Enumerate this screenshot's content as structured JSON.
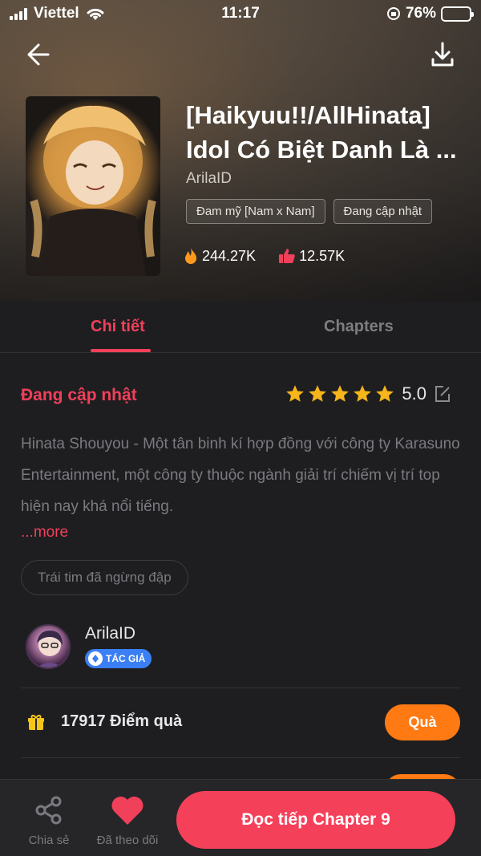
{
  "status_bar": {
    "carrier": "Viettel",
    "time": "11:17",
    "battery": "76%"
  },
  "book": {
    "title": "[Haikyuu!!/AllHinata] Idol Có Biệt Danh Là ...",
    "author": "ArilaID",
    "tags": [
      "Đam mỹ [Nam x Nam]",
      "Đang cập nhật"
    ],
    "views": "244.27K",
    "likes": "12.57K"
  },
  "tabs": {
    "detail": "Chi tiết",
    "chapters": "Chapters"
  },
  "detail": {
    "status": "Đang cập nhật",
    "rating": "5.0",
    "stars": 5,
    "description": "Hinata Shouyou - Một tân binh kí hợp đồng với công ty Karasuno Entertainment, một công ty thuộc ngành giải trí chiếm vị trí top hiện nay khá nổi tiếng.",
    "more": "...more",
    "chip": "Trái tim đã ngừng đập"
  },
  "author_card": {
    "name": "ArilaID",
    "badge": "TÁC GIẢ"
  },
  "gift": {
    "text": "17917 Điểm quà",
    "button": "Quà"
  },
  "bottom_bar": {
    "share": "Chia sẻ",
    "follow": "Đã theo dõi",
    "read": "Đọc tiếp Chapter 9"
  },
  "colors": {
    "accent": "#f0405a",
    "gift": "#ff7a12",
    "badge": "#3b7ff5",
    "star": "#f5b51b"
  }
}
